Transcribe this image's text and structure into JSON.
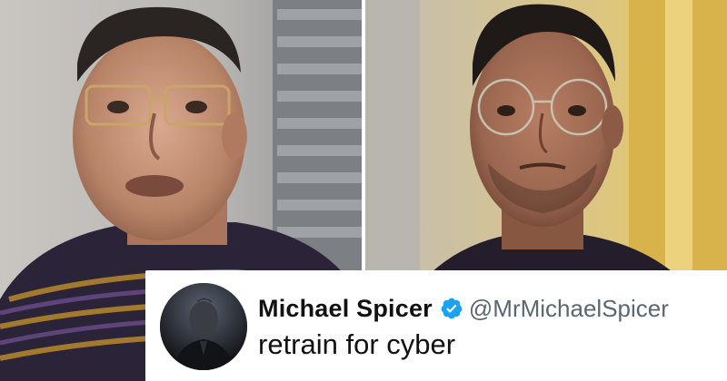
{
  "tweet": {
    "display_name": "Michael Spicer",
    "handle": "@MrMichaelSpicer",
    "text": "retrain for cyber",
    "verified": true,
    "verified_color": "#1DA1F2"
  },
  "icons": {
    "verified": "verified-badge-icon",
    "avatar": "profile-photo"
  }
}
